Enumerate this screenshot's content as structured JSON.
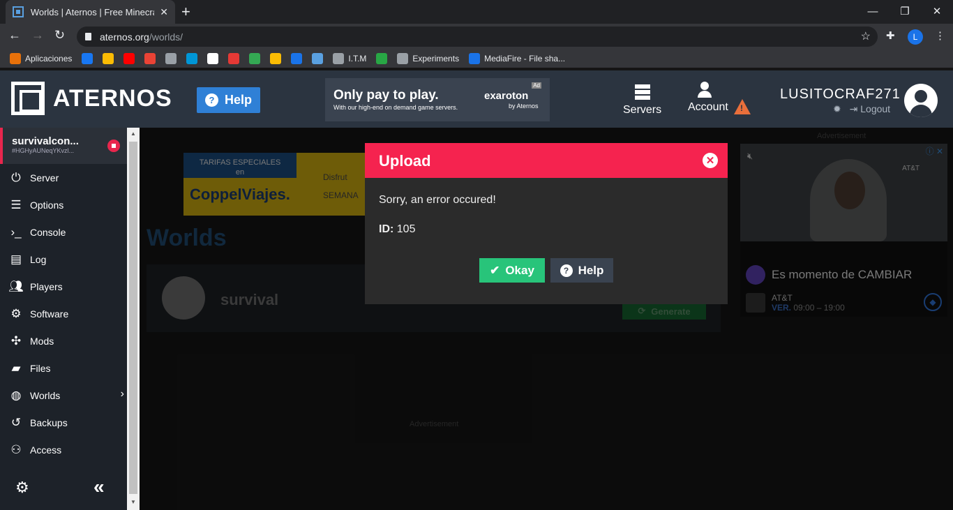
{
  "browser": {
    "tab_title": "Worlds | Aternos | Free Minecraft",
    "url_host": "aternos.org",
    "url_path": "/worlds/",
    "profile_initial": "L",
    "bookmarks": [
      {
        "label": "Aplicaciones",
        "color": "#e8710a"
      },
      {
        "label": "",
        "color": "#1877f2"
      },
      {
        "label": "",
        "color": "#fbbc04"
      },
      {
        "label": "",
        "color": "#ff0000"
      },
      {
        "label": "",
        "color": "#ea4335"
      },
      {
        "label": "",
        "color": "#9aa0a6"
      },
      {
        "label": "",
        "color": "#0096d6"
      },
      {
        "label": "",
        "color": "#ffffff"
      },
      {
        "label": "",
        "color": "#e53935"
      },
      {
        "label": "",
        "color": "#34a853"
      },
      {
        "label": "",
        "color": "#fbbc04"
      },
      {
        "label": "",
        "color": "#1a73e8"
      },
      {
        "label": "",
        "color": "#5aa0e0"
      },
      {
        "label": "I.T.M",
        "color": "#9aa0a6"
      },
      {
        "label": "",
        "color": "#28a745"
      },
      {
        "label": "Experiments",
        "color": "#9aa0a6"
      },
      {
        "label": "MediaFire - File sha...",
        "color": "#1a73e8"
      }
    ]
  },
  "header": {
    "logo_text": "ATERNOS",
    "help_label": "Help",
    "banner": {
      "title": "Only pay to play.",
      "subtitle": "With our high-end on demand game servers.",
      "brand": "exaroton",
      "by": "by Aternos",
      "ad": "Ad"
    },
    "servers_label": "Servers",
    "account_label": "Account",
    "username": "LUSITOCRAF271",
    "logout_label": "Logout"
  },
  "sidebar": {
    "server_name": "survivalcon...",
    "server_id": "#HGHyAUNeqYKvzl...",
    "items": [
      {
        "label": "Server",
        "icon": "power-icon"
      },
      {
        "label": "Options",
        "icon": "sliders-icon"
      },
      {
        "label": "Console",
        "icon": "terminal-icon"
      },
      {
        "label": "Log",
        "icon": "file-icon"
      },
      {
        "label": "Players",
        "icon": "users-icon"
      },
      {
        "label": "Software",
        "icon": "gears-icon"
      },
      {
        "label": "Mods",
        "icon": "puzzle-icon"
      },
      {
        "label": "Files",
        "icon": "folders-icon"
      },
      {
        "label": "Worlds",
        "icon": "globe-icon"
      },
      {
        "label": "Backups",
        "icon": "history-icon"
      },
      {
        "label": "Access",
        "icon": "user-lock-icon"
      }
    ]
  },
  "main": {
    "ad_top": {
      "line1": "TARIFAS ESPECIALES",
      "line2": "en",
      "logo": "CoppelViajes.",
      "text1": "Disfrut",
      "text2": "SEMANA"
    },
    "worlds_title": "Worlds",
    "world_name": "survival",
    "generate_label": "Generate",
    "advertisement": "Advertisement"
  },
  "right_ad": {
    "label": "Advertisement",
    "brand_small": "AT&T",
    "headline": "Es momento de CAMBIAR",
    "advertiser": "AT&T",
    "hours_prefix": "VER.",
    "hours": "09:00 – 19:00"
  },
  "modal": {
    "title": "Upload",
    "message": "Sorry, an error occured!",
    "id_label": "ID:",
    "id_value": "105",
    "okay_label": "Okay",
    "help_label": "Help"
  }
}
